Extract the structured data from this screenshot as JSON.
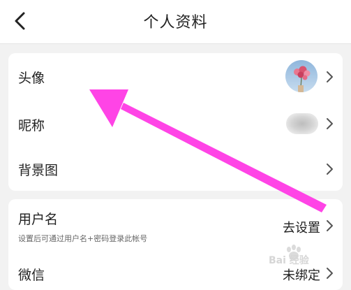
{
  "header": {
    "title": "个人资料"
  },
  "profile_section": {
    "avatar_label": "头像",
    "nickname_label": "昵称",
    "background_label": "背景图"
  },
  "account_section": {
    "username_label": "用户名",
    "username_hint": "设置后可通过用户名+密码登录此帐号",
    "username_value": "去设置",
    "wechat_label": "微信",
    "wechat_value": "未绑定"
  },
  "annotation": {
    "color": "#ff44e6"
  },
  "watermark": {
    "text": "Bai 经验"
  },
  "icons": [
    "back-chevron-icon",
    "chevron-right-icon",
    "avatar-photo",
    "pink-arrow-annotation",
    "baidu-paw-logo"
  ]
}
